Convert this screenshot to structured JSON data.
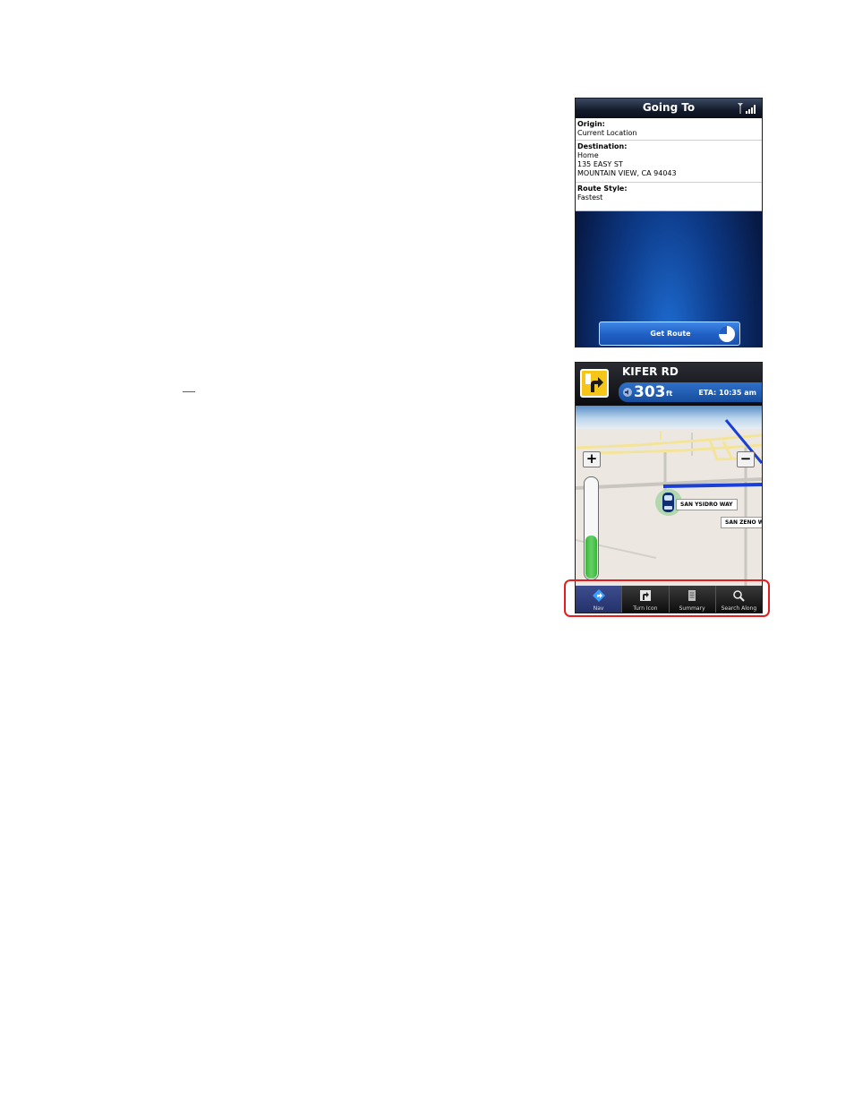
{
  "screen_going_to": {
    "title": "Going To",
    "origin": {
      "label": "Origin:",
      "value": "Current Location"
    },
    "destination": {
      "label": "Destination:",
      "name": "Home",
      "street": "135 EASY ST",
      "city": "MOUNTAIN VIEW, CA 94043"
    },
    "route_style": {
      "label": "Route Style:",
      "value": "Fastest"
    },
    "get_route_button": "Get Route"
  },
  "screen_navigation": {
    "street": "KIFER RD",
    "distance_value": "303",
    "distance_unit": "ft",
    "eta": "ETA: 10:35 am",
    "zoom_in": "+",
    "zoom_out": "−",
    "zoom_level": 0.42,
    "map_labels": {
      "san_ysidro": "SAN YSIDRO WAY",
      "san_zeno": "SAN ZENO W"
    },
    "tabs": [
      {
        "label": "Nav",
        "icon": "nav-diamond-icon",
        "active": true
      },
      {
        "label": "Turn Icon",
        "icon": "turn-arrow-icon",
        "active": false
      },
      {
        "label": "Summary",
        "icon": "summary-list-icon",
        "active": false
      },
      {
        "label": "Search Along",
        "icon": "magnifier-icon",
        "active": false
      }
    ]
  },
  "colors": {
    "highlight": "#e41e1e",
    "route_line": "#1a3fd6",
    "turn_badge": "#f5c518",
    "button_blue": "#1f5fc4"
  }
}
